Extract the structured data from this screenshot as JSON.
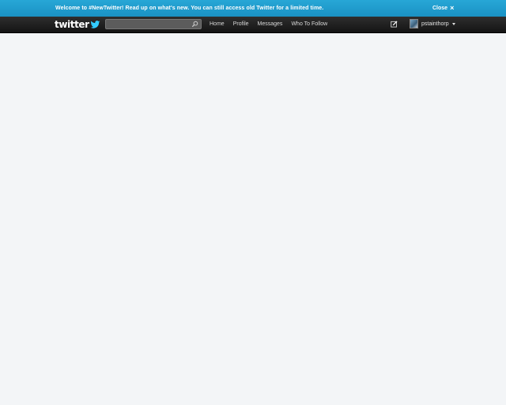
{
  "banner": {
    "message": "Welcome to #NewTwitter! Read up on what's new. You can still access old Twitter for a limited time.",
    "close_label": "Close",
    "close_glyph": "×"
  },
  "topbar": {
    "logo_text": "twitter",
    "search": {
      "value": "",
      "placeholder": ""
    },
    "nav": {
      "home": "Home",
      "profile": "Profile",
      "messages": "Messages",
      "who_to_follow": "Who To Follow"
    },
    "account": {
      "username": "pstainthorp"
    }
  },
  "colors": {
    "banner_bg": "#1a9acb",
    "topbar_bg": "#1e1e1e",
    "page_bg": "#f3f5f7",
    "brand_blue": "#33ccff"
  },
  "icons": {
    "logo_bird": "bird-icon",
    "search": "search-icon",
    "compose": "compose-icon",
    "caret": "caret-down-icon"
  }
}
